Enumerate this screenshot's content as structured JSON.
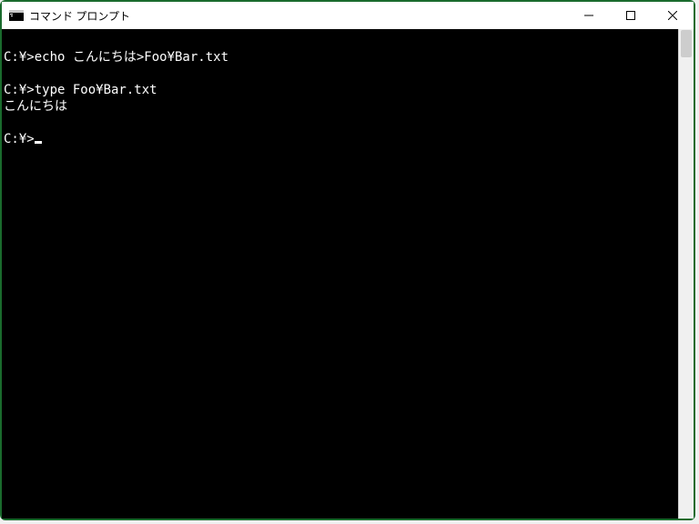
{
  "window": {
    "title": "コマンド プロンプト"
  },
  "terminal": {
    "lines": [
      "",
      "C:¥>echo こんにちは>Foo¥Bar.txt",
      "",
      "C:¥>type Foo¥Bar.txt",
      "こんにちは",
      "",
      "C:¥>"
    ],
    "prompt": "C:¥>",
    "cursor_line_index": 6
  }
}
